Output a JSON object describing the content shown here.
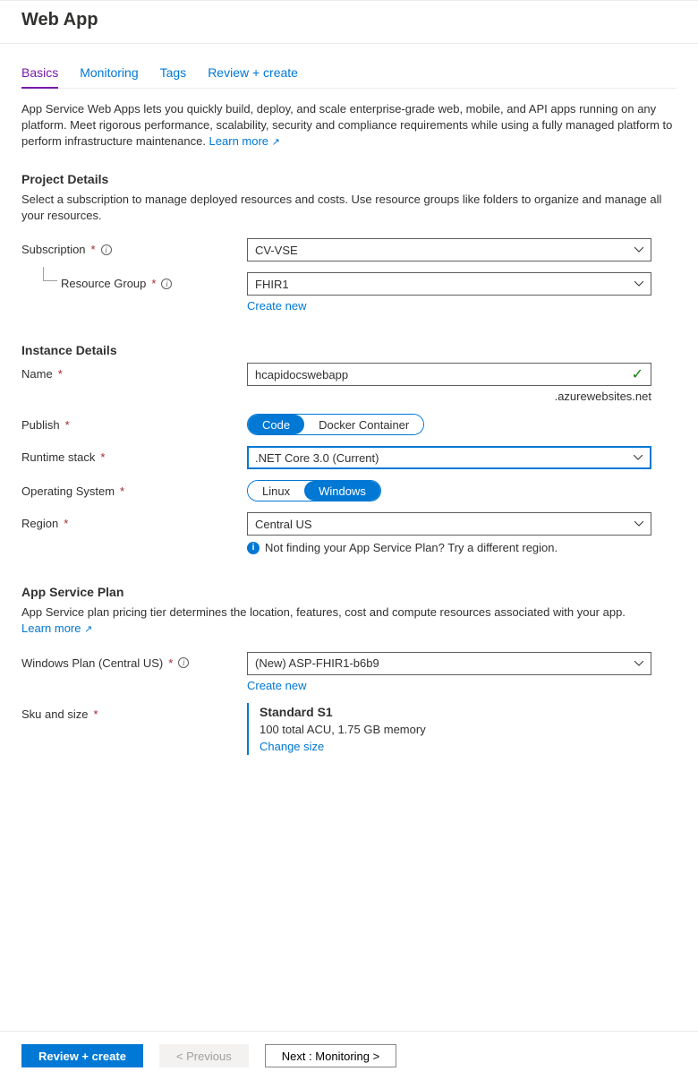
{
  "header": {
    "title": "Web App"
  },
  "tabs": {
    "basics": "Basics",
    "monitoring": "Monitoring",
    "tags": "Tags",
    "review": "Review + create"
  },
  "intro": {
    "text": "App Service Web Apps lets you quickly build, deploy, and scale enterprise-grade web, mobile, and API apps running on any platform. Meet rigorous performance, scalability, security and compliance requirements while using a fully managed platform to perform infrastructure maintenance.  ",
    "learn_more": "Learn more"
  },
  "project": {
    "title": "Project Details",
    "desc": "Select a subscription to manage deployed resources and costs. Use resource groups like folders to organize and manage all your resources.",
    "subscription_label": "Subscription",
    "subscription_value": "CV-VSE",
    "resource_group_label": "Resource Group",
    "resource_group_value": "FHIR1",
    "create_new": "Create new"
  },
  "instance": {
    "title": "Instance Details",
    "name_label": "Name",
    "name_value": "hcapidocswebapp",
    "name_suffix": ".azurewebsites.net",
    "publish_label": "Publish",
    "publish_code": "Code",
    "publish_docker": "Docker Container",
    "runtime_label": "Runtime stack",
    "runtime_value": ".NET Core 3.0 (Current)",
    "os_label": "Operating System",
    "os_linux": "Linux",
    "os_windows": "Windows",
    "region_label": "Region",
    "region_value": "Central US",
    "region_hint": "Not finding your App Service Plan? Try a different region."
  },
  "plan": {
    "title": "App Service Plan",
    "desc": "App Service plan pricing tier determines the location, features, cost and compute resources associated with your app.",
    "learn_more": "Learn more",
    "windows_plan_label": "Windows Plan (Central US)",
    "windows_plan_value": "(New) ASP-FHIR1-b6b9",
    "create_new": "Create new",
    "sku_label": "Sku and size",
    "sku_name": "Standard S1",
    "sku_desc": "100 total ACU, 1.75 GB memory",
    "change_size": "Change size"
  },
  "footer": {
    "review": "Review + create",
    "previous": "< Previous",
    "next": "Next : Monitoring >"
  }
}
